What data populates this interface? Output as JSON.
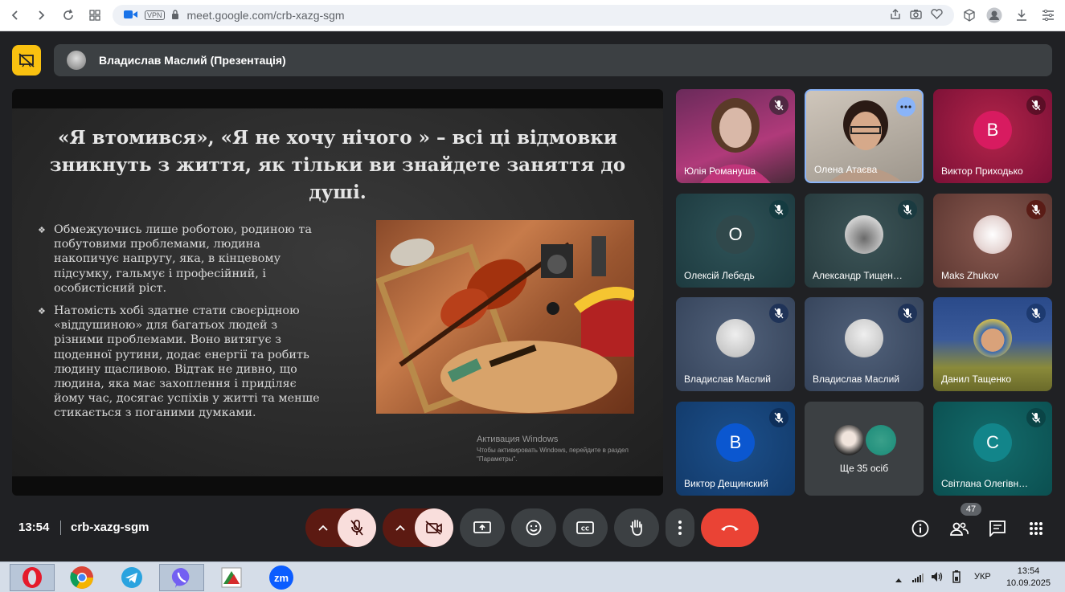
{
  "browser": {
    "url": "meet.google.com/crb-xazg-sgm",
    "vpn_label": "VPN"
  },
  "header": {
    "presenter_title": "Владислав Маслий (Презентація)"
  },
  "slide": {
    "title": "«Я втомився», «Я не хочу нічого » – всі ці відмовки зникнуть з життя, як тільки ви знайдете заняття до душі.",
    "bullets": [
      "Обмежуючись лише роботою, родиною та побутовими проблемами, людина накопичує напругу, яка, в кінцевому підсумку, гальмує і професійний, і особистісний ріст.",
      "Натомість хобі здатне стати своєрідною «віддушиною» для багатьох людей з різними проблемами. Воно витягує з щоденної рутини, додає енергії та робить людину щасливою. Відтак не дивно, що людина, яка має захоплення і приділяє йому час, досягає успіхів у житті та менше стикається з поганими думками."
    ],
    "bullet_marker": "❖",
    "activation_title": "Активация Windows",
    "activation_sub": "Чтобы активировать Windows, перейдите в раздел \"Параметры\"."
  },
  "participants": [
    {
      "name": "Юлія Романуша",
      "letter": ""
    },
    {
      "name": "Олена Атаєва",
      "letter": ""
    },
    {
      "name": "Виктор Приходько",
      "letter": "В"
    },
    {
      "name": "Олексій Лебедь",
      "letter": "О"
    },
    {
      "name": "Александр Тищен…",
      "letter": ""
    },
    {
      "name": "Maks Zhukov",
      "letter": ""
    },
    {
      "name": "Владислав Маслий",
      "letter": ""
    },
    {
      "name": "Владислав Маслий",
      "letter": ""
    },
    {
      "name": "Данил Тащенко",
      "letter": ""
    },
    {
      "name": "Виктор Дещинский",
      "letter": "В"
    },
    {
      "name": "Ще 35 осіб",
      "letter": ""
    },
    {
      "name": "Світлана Олегівн…",
      "letter": "С"
    }
  ],
  "bottom": {
    "time": "13:54",
    "meeting_code": "crb-xazg-sgm",
    "people_count": "47"
  },
  "taskbar": {
    "lang": "УКР",
    "clock_time": "13:54",
    "clock_date": "10.09.2025",
    "zoom_label": "zm"
  },
  "colors": {
    "meet_bg": "#202124",
    "end_call": "#ea4335",
    "muted_btn": "#f9dedc",
    "highlight": "#f9c110"
  }
}
